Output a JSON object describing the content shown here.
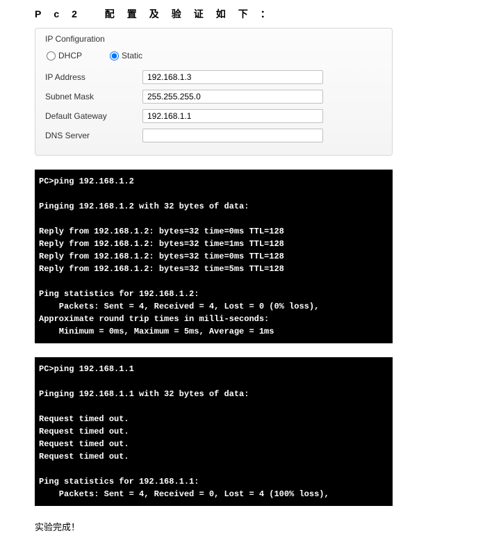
{
  "title": "Pc2 配置及验证如下：",
  "ip_config": {
    "legend": "IP Configuration",
    "dhcp_label": "DHCP",
    "static_label": "Static",
    "mode": "static",
    "fields": {
      "ip_address_label": "IP Address",
      "ip_address_value": "192.168.1.3",
      "subnet_mask_label": "Subnet Mask",
      "subnet_mask_value": "255.255.255.0",
      "default_gateway_label": "Default Gateway",
      "default_gateway_value": "192.168.1.1",
      "dns_server_label": "DNS Server",
      "dns_server_value": ""
    }
  },
  "terminal1": "PC>ping 192.168.1.2\n\nPinging 192.168.1.2 with 32 bytes of data:\n\nReply from 192.168.1.2: bytes=32 time=0ms TTL=128\nReply from 192.168.1.2: bytes=32 time=1ms TTL=128\nReply from 192.168.1.2: bytes=32 time=0ms TTL=128\nReply from 192.168.1.2: bytes=32 time=5ms TTL=128\n\nPing statistics for 192.168.1.2:\n    Packets: Sent = 4, Received = 4, Lost = 0 (0% loss),\nApproximate round trip times in milli-seconds:\n    Minimum = 0ms, Maximum = 5ms, Average = 1ms",
  "terminal2": "PC>ping 192.168.1.1\n\nPinging 192.168.1.1 with 32 bytes of data:\n\nRequest timed out.\nRequest timed out.\nRequest timed out.\nRequest timed out.\n\nPing statistics for 192.168.1.1:\n    Packets: Sent = 4, Received = 0, Lost = 4 (100% loss),",
  "done": "实验完成！"
}
